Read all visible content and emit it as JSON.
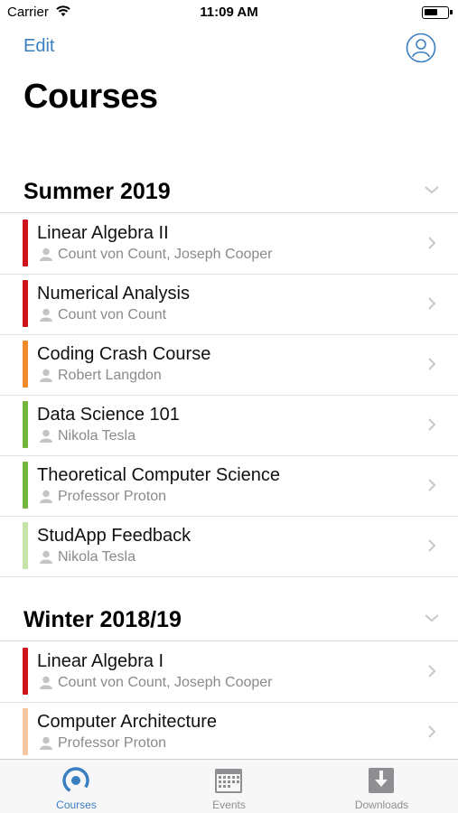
{
  "status": {
    "carrier": "Carrier",
    "time": "11:09 AM"
  },
  "nav": {
    "edit_label": "Edit",
    "title": "Courses"
  },
  "sections": [
    {
      "title": "Summer 2019",
      "courses": [
        {
          "name": "Linear Algebra II",
          "lecturer": "Count von Count, Joseph Cooper",
          "color": "#d0131a"
        },
        {
          "name": "Numerical Analysis",
          "lecturer": "Count von Count",
          "color": "#d0131a"
        },
        {
          "name": "Coding Crash Course",
          "lecturer": "Robert Langdon",
          "color": "#f08a2a"
        },
        {
          "name": "Data Science 101",
          "lecturer": "Nikola Tesla",
          "color": "#72b539"
        },
        {
          "name": "Theoretical Computer Science",
          "lecturer": "Professor Proton",
          "color": "#72b539"
        },
        {
          "name": "StudApp Feedback",
          "lecturer": "Nikola Tesla",
          "color": "#c6e3a8"
        }
      ]
    },
    {
      "title": "Winter 2018/19",
      "courses": [
        {
          "name": "Linear Algebra I",
          "lecturer": "Count von Count, Joseph Cooper",
          "color": "#d0131a"
        },
        {
          "name": "Computer Architecture",
          "lecturer": "Professor Proton",
          "color": "#f6c6a0"
        }
      ]
    }
  ],
  "tabs": [
    {
      "label": "Courses",
      "icon": "courses-icon",
      "active": true
    },
    {
      "label": "Events",
      "icon": "calendar-icon",
      "active": false
    },
    {
      "label": "Downloads",
      "icon": "download-icon",
      "active": false
    }
  ],
  "colors": {
    "accent": "#3a7fc2",
    "tab_inactive": "#8e8e93"
  }
}
